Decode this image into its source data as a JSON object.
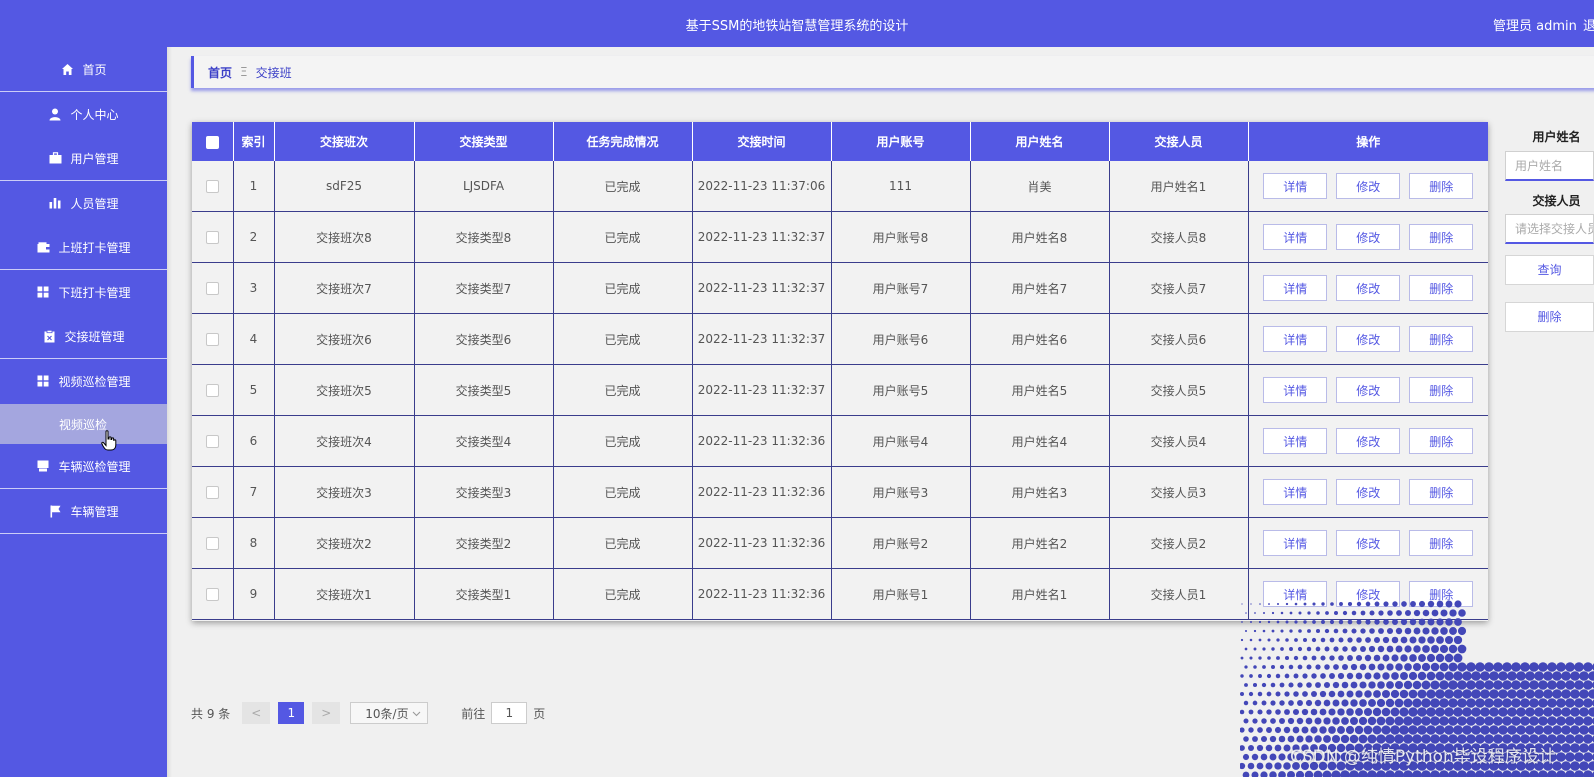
{
  "header": {
    "title": "基于SSM的地铁站智慧管理系统的设计",
    "user": "管理员 admin",
    "logout": "退出"
  },
  "sidebar": {
    "items": [
      {
        "label": "首页",
        "icon": "home-icon"
      },
      {
        "label": "个人中心",
        "icon": "user-icon"
      },
      {
        "label": "用户管理",
        "icon": "briefcase-icon"
      },
      {
        "label": "人员管理",
        "icon": "bar-chart-icon"
      },
      {
        "label": "上班打卡管理",
        "icon": "wallet-icon"
      },
      {
        "label": "下班打卡管理",
        "icon": "grid-icon"
      },
      {
        "label": "交接班管理",
        "icon": "clipboard-icon"
      },
      {
        "label": "视频巡检管理",
        "icon": "grid-icon"
      },
      {
        "label": "视频巡检",
        "icon": ""
      },
      {
        "label": "车辆巡检管理",
        "icon": "printer-icon"
      },
      {
        "label": "车辆管理",
        "icon": "flag-icon"
      }
    ]
  },
  "breadcrumb": {
    "home": "首页",
    "separator": "Ξ",
    "current": "交接班"
  },
  "table": {
    "headers": [
      "索引",
      "交接班次",
      "交接类型",
      "任务完成情况",
      "交接时间",
      "用户账号",
      "用户姓名",
      "交接人员",
      "操作"
    ],
    "actions": {
      "detail": "详情",
      "edit": "修改",
      "delete": "删除"
    },
    "rows": [
      [
        "1",
        "sdF25",
        "LJSDFA",
        "已完成",
        "2022-11-23 11:37:06",
        "111",
        "肖美",
        "用户姓名1"
      ],
      [
        "2",
        "交接班次8",
        "交接类型8",
        "已完成",
        "2022-11-23 11:32:37",
        "用户账号8",
        "用户姓名8",
        "交接人员8"
      ],
      [
        "3",
        "交接班次7",
        "交接类型7",
        "已完成",
        "2022-11-23 11:32:37",
        "用户账号7",
        "用户姓名7",
        "交接人员7"
      ],
      [
        "4",
        "交接班次6",
        "交接类型6",
        "已完成",
        "2022-11-23 11:32:37",
        "用户账号6",
        "用户姓名6",
        "交接人员6"
      ],
      [
        "5",
        "交接班次5",
        "交接类型5",
        "已完成",
        "2022-11-23 11:32:37",
        "用户账号5",
        "用户姓名5",
        "交接人员5"
      ],
      [
        "6",
        "交接班次4",
        "交接类型4",
        "已完成",
        "2022-11-23 11:32:36",
        "用户账号4",
        "用户姓名4",
        "交接人员4"
      ],
      [
        "7",
        "交接班次3",
        "交接类型3",
        "已完成",
        "2022-11-23 11:32:36",
        "用户账号3",
        "用户姓名3",
        "交接人员3"
      ],
      [
        "8",
        "交接班次2",
        "交接类型2",
        "已完成",
        "2022-11-23 11:32:36",
        "用户账号2",
        "用户姓名2",
        "交接人员2"
      ],
      [
        "9",
        "交接班次1",
        "交接类型1",
        "已完成",
        "2022-11-23 11:32:36",
        "用户账号1",
        "用户姓名1",
        "交接人员1"
      ]
    ]
  },
  "search": {
    "name_label": "用户姓名",
    "name_placeholder": "用户姓名",
    "handover_label": "交接人员",
    "handover_placeholder": "请选择交接人员",
    "query_button": "查询",
    "delete_button": "删除"
  },
  "pagination": {
    "total": "共 9 条",
    "prev": "<",
    "page": "1",
    "next": ">",
    "page_size": "10条/页",
    "goto_prefix": "前往",
    "goto_value": "1",
    "goto_suffix": "页"
  },
  "watermark": "CSDN @纯情Python毕设程序设计",
  "colors": {
    "primary": "#5458e3",
    "submenu_active": "#a4a6df"
  }
}
